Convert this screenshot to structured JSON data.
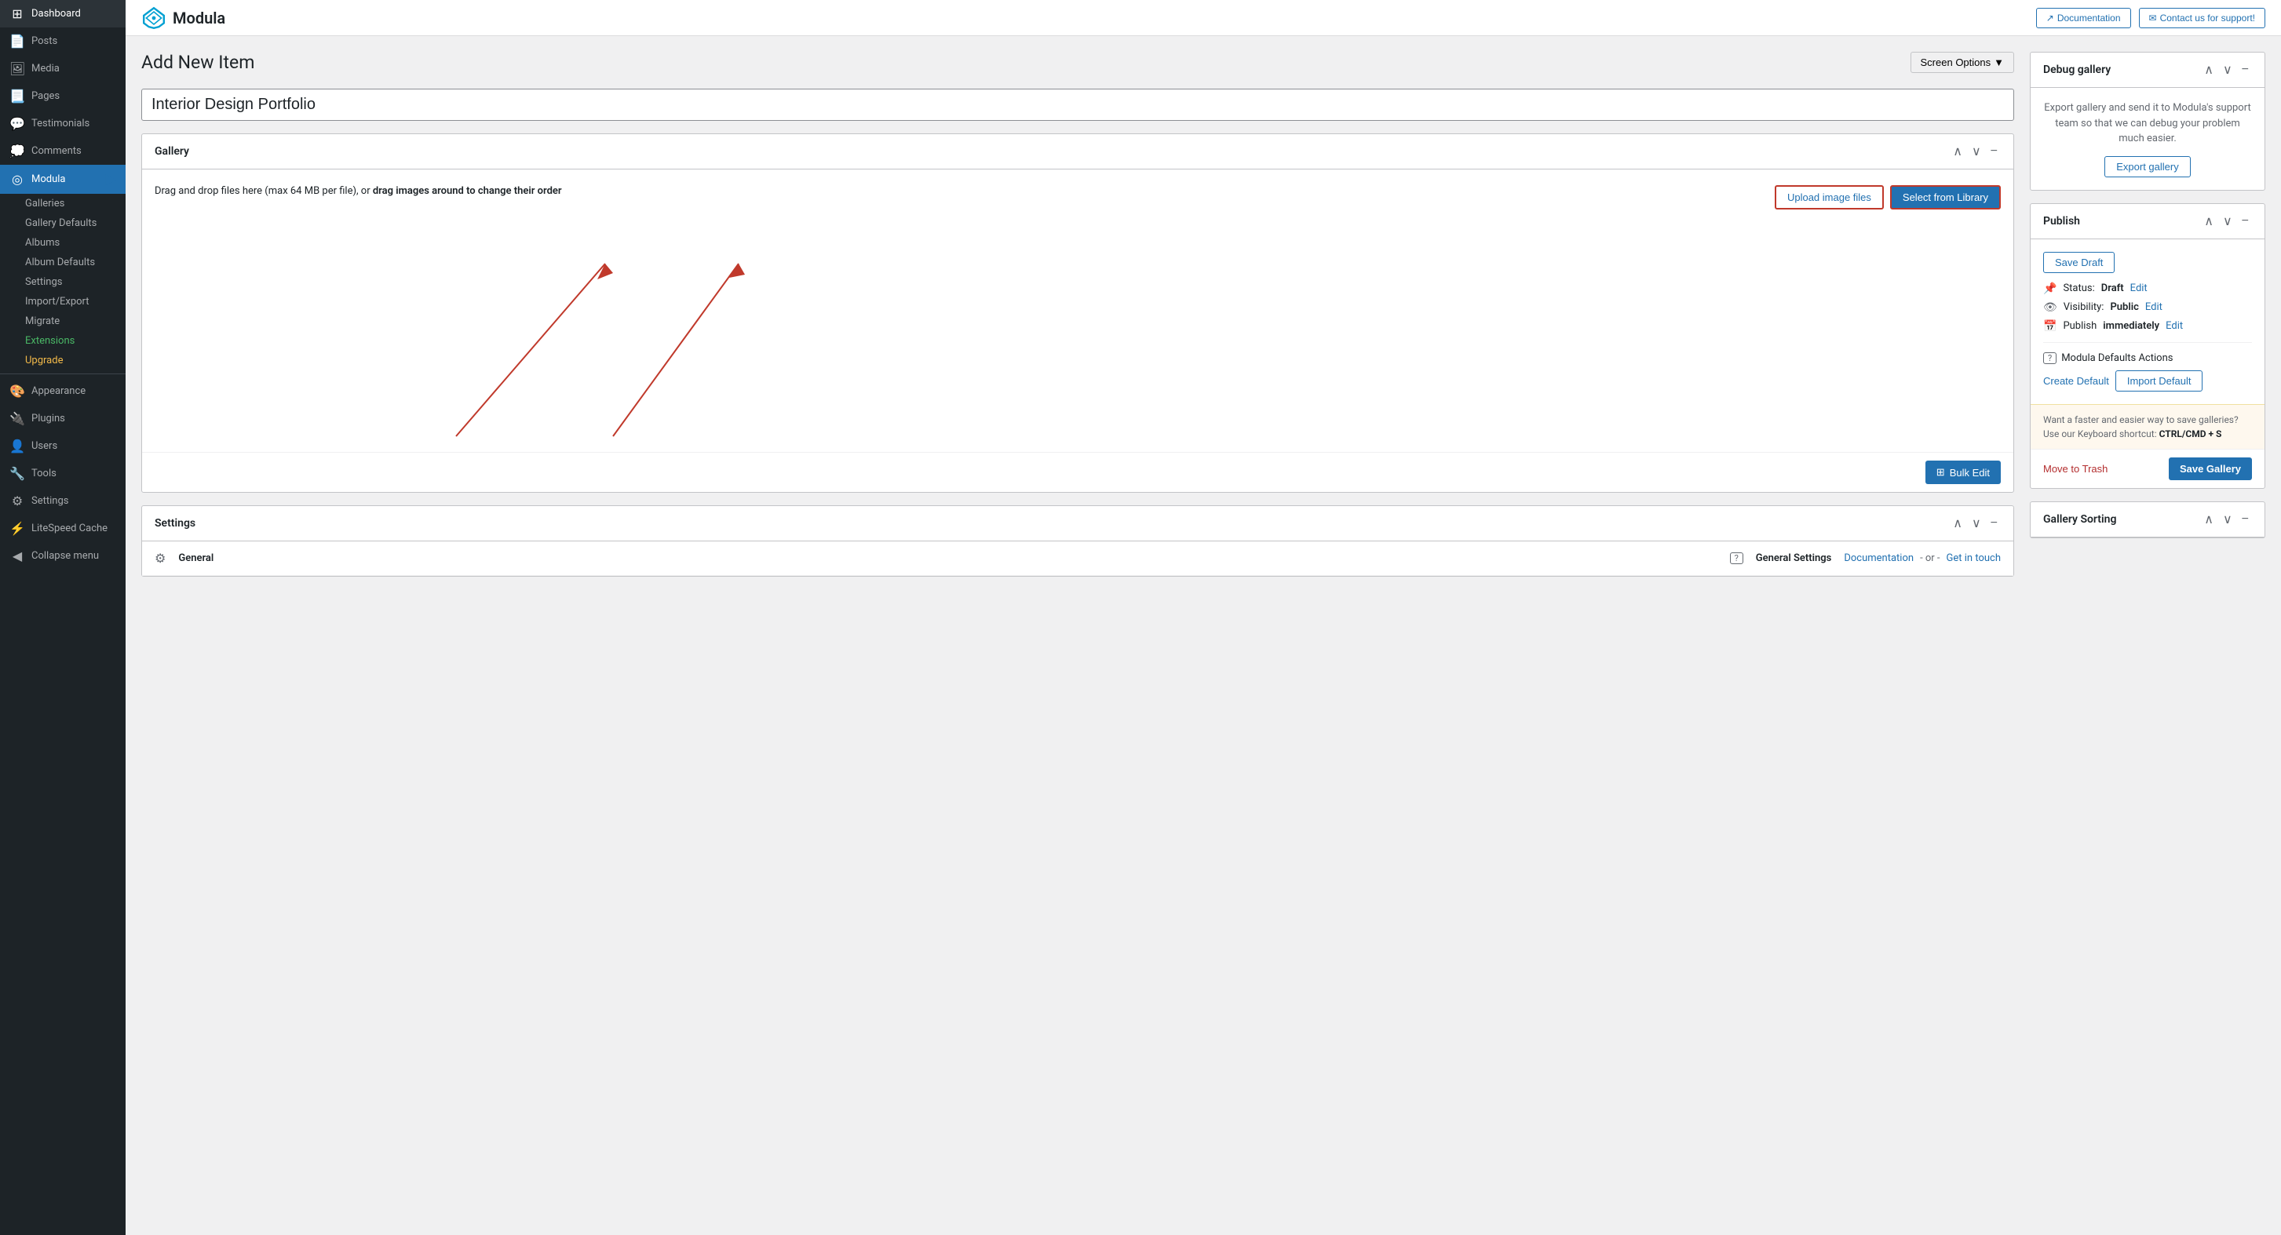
{
  "sidebar": {
    "items": [
      {
        "id": "dashboard",
        "label": "Dashboard",
        "icon": "⊞",
        "active": false
      },
      {
        "id": "posts",
        "label": "Posts",
        "icon": "📄",
        "active": false
      },
      {
        "id": "media",
        "label": "Media",
        "icon": "🖼",
        "active": false
      },
      {
        "id": "pages",
        "label": "Pages",
        "icon": "📃",
        "active": false
      },
      {
        "id": "testimonials",
        "label": "Testimonials",
        "icon": "💬",
        "active": false
      },
      {
        "id": "comments",
        "label": "Comments",
        "icon": "💭",
        "active": false
      },
      {
        "id": "modula",
        "label": "Modula",
        "icon": "◎",
        "active": true
      }
    ],
    "modula_sub": [
      {
        "id": "galleries",
        "label": "Galleries"
      },
      {
        "id": "gallery-defaults",
        "label": "Gallery Defaults"
      },
      {
        "id": "albums",
        "label": "Albums"
      },
      {
        "id": "album-defaults",
        "label": "Album Defaults"
      },
      {
        "id": "settings",
        "label": "Settings"
      },
      {
        "id": "import-export",
        "label": "Import/Export"
      },
      {
        "id": "migrate",
        "label": "Migrate"
      },
      {
        "id": "extensions",
        "label": "Extensions",
        "color": "green"
      },
      {
        "id": "upgrade",
        "label": "Upgrade",
        "color": "yellow"
      }
    ],
    "bottom_items": [
      {
        "id": "appearance",
        "label": "Appearance",
        "icon": "🎨"
      },
      {
        "id": "plugins",
        "label": "Plugins",
        "icon": "🔌"
      },
      {
        "id": "users",
        "label": "Users",
        "icon": "👤"
      },
      {
        "id": "tools",
        "label": "Tools",
        "icon": "🔧"
      },
      {
        "id": "settings",
        "label": "Settings",
        "icon": "⚙"
      },
      {
        "id": "litespeed",
        "label": "LiteSpeed Cache",
        "icon": "⚡"
      },
      {
        "id": "collapse",
        "label": "Collapse menu",
        "icon": "◀"
      }
    ]
  },
  "topbar": {
    "brand": "Modula",
    "doc_button": "Documentation",
    "contact_button": "Contact us for support!"
  },
  "page": {
    "title": "Add New Item",
    "screen_options": "Screen Options",
    "gallery_title": "Interior Design Portfolio"
  },
  "gallery_panel": {
    "title": "Gallery",
    "drop_text_normal": "Drag and drop files here (max 64 MB per file), or ",
    "drop_text_bold": "drag images around to change their order",
    "upload_button": "Upload image files",
    "library_button": "Select from Library",
    "bulk_edit_button": "Bulk Edit"
  },
  "settings_panel": {
    "title": "Settings",
    "general_icon": "⚙",
    "general_label": "General",
    "general_settings_label": "General Settings",
    "documentation_link": "Documentation",
    "or_text": "- or -",
    "get_in_touch_link": "Get in touch"
  },
  "debug_panel": {
    "title": "Debug gallery",
    "description": "Export gallery and send it to Modula's support team so that we can debug your problem much easier.",
    "export_button": "Export gallery"
  },
  "publish_panel": {
    "title": "Publish",
    "save_draft_button": "Save Draft",
    "status_label": "Status:",
    "status_value": "Draft",
    "status_edit": "Edit",
    "visibility_label": "Visibility:",
    "visibility_value": "Public",
    "visibility_edit": "Edit",
    "publish_label": "Publish",
    "publish_immediately": "immediately",
    "publish_edit": "Edit",
    "defaults_label": "Modula Defaults Actions",
    "create_default": "Create Default",
    "import_default": "Import Default",
    "tip_text": "Want a faster and easier way to save galleries? Use our Keyboard shortcut:",
    "tip_shortcut": "CTRL/CMD + S",
    "move_trash": "Move to Trash",
    "save_gallery": "Save Gallery"
  },
  "gallery_sorting_panel": {
    "title": "Gallery Sorting"
  }
}
